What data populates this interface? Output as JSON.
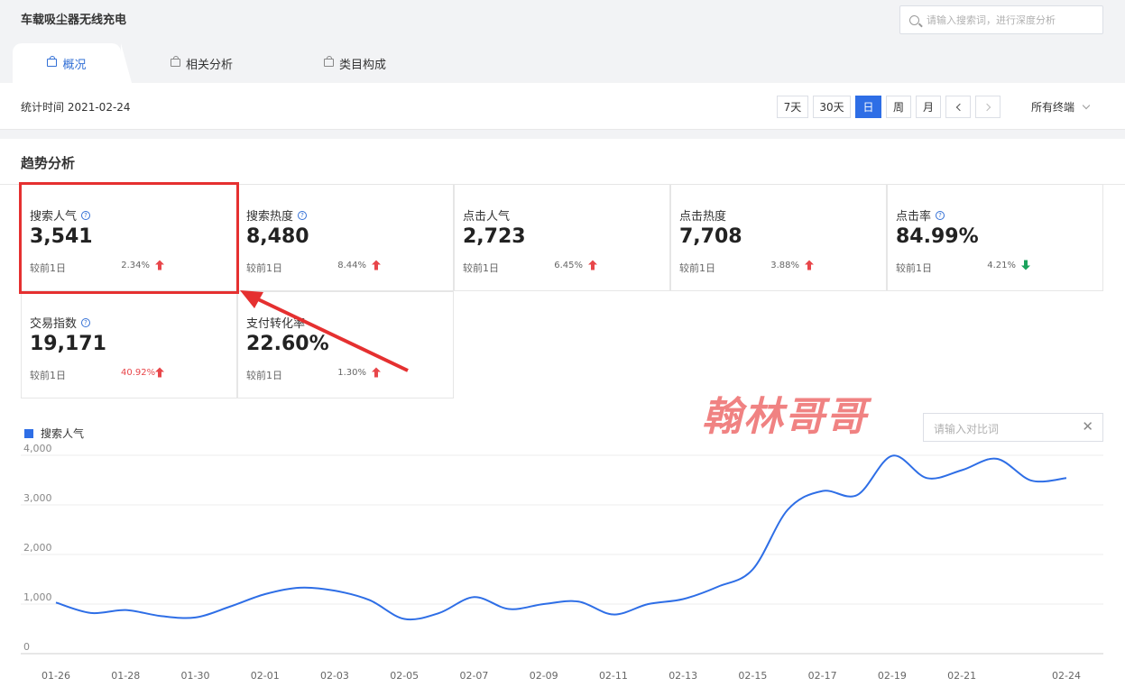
{
  "header": {
    "keyword": "车载吸尘器无线充电",
    "search_placeholder": "请输入搜索词，进行深度分析"
  },
  "tabs": [
    {
      "label": "概况",
      "active": true
    },
    {
      "label": "相关分析",
      "active": false
    },
    {
      "label": "类目构成",
      "active": false
    }
  ],
  "filter": {
    "stat_time": "统计时间 2021-02-24",
    "ranges": [
      "7天",
      "30天",
      "日",
      "周",
      "月"
    ],
    "active_range": "日",
    "terminal": "所有终端"
  },
  "section_title": "趋势分析",
  "metrics": [
    {
      "label": "搜索人气",
      "help": true,
      "value": "3,541",
      "compare": "较前1日",
      "pct": "2.34%",
      "trend": "up",
      "pct_color": "gray"
    },
    {
      "label": "搜索热度",
      "help": true,
      "value": "8,480",
      "compare": "较前1日",
      "pct": "8.44%",
      "trend": "up",
      "pct_color": "gray"
    },
    {
      "label": "点击人气",
      "help": false,
      "value": "2,723",
      "compare": "较前1日",
      "pct": "6.45%",
      "trend": "up",
      "pct_color": "gray"
    },
    {
      "label": "点击热度",
      "help": false,
      "value": "7,708",
      "compare": "较前1日",
      "pct": "3.88%",
      "trend": "up",
      "pct_color": "gray"
    },
    {
      "label": "点击率",
      "help": true,
      "value": "84.99%",
      "compare": "较前1日",
      "pct": "4.21%",
      "trend": "down",
      "pct_color": "gray"
    },
    {
      "label": "交易指数",
      "help": true,
      "value": "19,171",
      "compare": "较前1日",
      "pct": "40.92%",
      "trend": "up",
      "pct_color": "red"
    },
    {
      "label": "支付转化率",
      "help": false,
      "value": "22.60%",
      "compare": "较前1日",
      "pct": "1.30%",
      "trend": "up",
      "pct_color": "gray"
    }
  ],
  "watermark": "翰林哥哥",
  "compare_placeholder": "请输入对比词",
  "colors": {
    "accent": "#2e6ee6",
    "up": "#e8464a",
    "down": "#1aa35c",
    "highlight": "#e53030"
  },
  "chart_data": {
    "type": "line",
    "legend": "搜索人气",
    "y_ticks": [
      "0",
      "1,000",
      "2,000",
      "3,000",
      "4,000"
    ],
    "ylim": [
      0,
      4000
    ],
    "x_tick_labels": [
      "01-26",
      "01-28",
      "01-30",
      "02-01",
      "02-03",
      "02-05",
      "02-07",
      "02-09",
      "02-11",
      "02-13",
      "02-15",
      "02-17",
      "02-19",
      "02-21",
      "02-24"
    ],
    "series": [
      {
        "name": "搜索人气",
        "x": [
          "01-26",
          "01-27",
          "01-28",
          "01-29",
          "01-30",
          "01-31",
          "02-01",
          "02-02",
          "02-03",
          "02-04",
          "02-05",
          "02-06",
          "02-07",
          "02-08",
          "02-09",
          "02-10",
          "02-11",
          "02-12",
          "02-13",
          "02-14",
          "02-15",
          "02-16",
          "02-17",
          "02-18",
          "02-19",
          "02-20",
          "02-21",
          "02-22",
          "02-23",
          "02-24"
        ],
        "values": [
          1030,
          820,
          880,
          760,
          730,
          950,
          1200,
          1330,
          1270,
          1080,
          700,
          820,
          1140,
          900,
          1000,
          1050,
          790,
          1000,
          1100,
          1350,
          1700,
          2900,
          3280,
          3200,
          3990,
          3540,
          3700,
          3930,
          3490,
          3541
        ]
      }
    ]
  }
}
